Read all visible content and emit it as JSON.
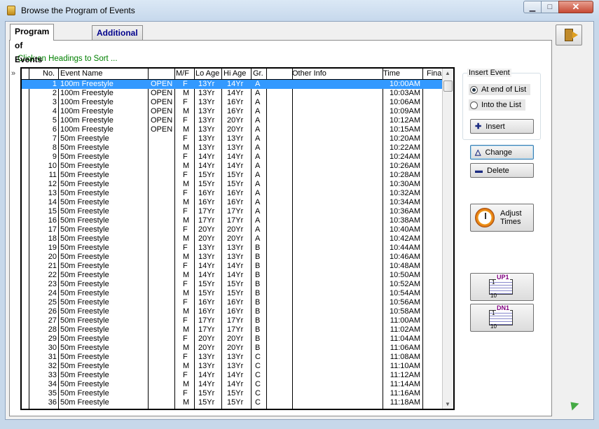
{
  "window": {
    "title": "Browse the Program of Events"
  },
  "tabs": [
    {
      "label": "Program of Events"
    },
    {
      "label": "Additional Program Items"
    }
  ],
  "hint": "Click on Headings to Sort ...",
  "grid": {
    "columns": [
      "No.",
      "Event Name",
      "",
      "M/F",
      "Lo Age",
      "Hi Age",
      "Gr.",
      "",
      "Other Info",
      "Time",
      "Final"
    ],
    "rows": [
      [
        "1",
        "100m Freestyle",
        "OPEN",
        "F",
        "13Yr",
        "14Yr",
        "A",
        "10:00AM"
      ],
      [
        "2",
        "100m Freestyle",
        "OPEN",
        "M",
        "13Yr",
        "14Yr",
        "A",
        "10:03AM"
      ],
      [
        "3",
        "100m Freestyle",
        "OPEN",
        "F",
        "13Yr",
        "16Yr",
        "A",
        "10:06AM"
      ],
      [
        "4",
        "100m Freestyle",
        "OPEN",
        "M",
        "13Yr",
        "16Yr",
        "A",
        "10:09AM"
      ],
      [
        "5",
        "100m Freestyle",
        "OPEN",
        "F",
        "13Yr",
        "20Yr",
        "A",
        "10:12AM"
      ],
      [
        "6",
        "100m Freestyle",
        "OPEN",
        "M",
        "13Yr",
        "20Yr",
        "A",
        "10:15AM"
      ],
      [
        "7",
        "50m Freestyle",
        "",
        "F",
        "13Yr",
        "13Yr",
        "A",
        "10:20AM"
      ],
      [
        "8",
        "50m Freestyle",
        "",
        "M",
        "13Yr",
        "13Yr",
        "A",
        "10:22AM"
      ],
      [
        "9",
        "50m Freestyle",
        "",
        "F",
        "14Yr",
        "14Yr",
        "A",
        "10:24AM"
      ],
      [
        "10",
        "50m Freestyle",
        "",
        "M",
        "14Yr",
        "14Yr",
        "A",
        "10:26AM"
      ],
      [
        "11",
        "50m Freestyle",
        "",
        "F",
        "15Yr",
        "15Yr",
        "A",
        "10:28AM"
      ],
      [
        "12",
        "50m Freestyle",
        "",
        "M",
        "15Yr",
        "15Yr",
        "A",
        "10:30AM"
      ],
      [
        "13",
        "50m Freestyle",
        "",
        "F",
        "16Yr",
        "16Yr",
        "A",
        "10:32AM"
      ],
      [
        "14",
        "50m Freestyle",
        "",
        "M",
        "16Yr",
        "16Yr",
        "A",
        "10:34AM"
      ],
      [
        "15",
        "50m Freestyle",
        "",
        "F",
        "17Yr",
        "17Yr",
        "A",
        "10:36AM"
      ],
      [
        "16",
        "50m Freestyle",
        "",
        "M",
        "17Yr",
        "17Yr",
        "A",
        "10:38AM"
      ],
      [
        "17",
        "50m Freestyle",
        "",
        "F",
        "20Yr",
        "20Yr",
        "A",
        "10:40AM"
      ],
      [
        "18",
        "50m Freestyle",
        "",
        "M",
        "20Yr",
        "20Yr",
        "A",
        "10:42AM"
      ],
      [
        "19",
        "50m Freestyle",
        "",
        "F",
        "13Yr",
        "13Yr",
        "B",
        "10:44AM"
      ],
      [
        "20",
        "50m Freestyle",
        "",
        "M",
        "13Yr",
        "13Yr",
        "B",
        "10:46AM"
      ],
      [
        "21",
        "50m Freestyle",
        "",
        "F",
        "14Yr",
        "14Yr",
        "B",
        "10:48AM"
      ],
      [
        "22",
        "50m Freestyle",
        "",
        "M",
        "14Yr",
        "14Yr",
        "B",
        "10:50AM"
      ],
      [
        "23",
        "50m Freestyle",
        "",
        "F",
        "15Yr",
        "15Yr",
        "B",
        "10:52AM"
      ],
      [
        "24",
        "50m Freestyle",
        "",
        "M",
        "15Yr",
        "15Yr",
        "B",
        "10:54AM"
      ],
      [
        "25",
        "50m Freestyle",
        "",
        "F",
        "16Yr",
        "16Yr",
        "B",
        "10:56AM"
      ],
      [
        "26",
        "50m Freestyle",
        "",
        "M",
        "16Yr",
        "16Yr",
        "B",
        "10:58AM"
      ],
      [
        "27",
        "50m Freestyle",
        "",
        "F",
        "17Yr",
        "17Yr",
        "B",
        "11:00AM"
      ],
      [
        "28",
        "50m Freestyle",
        "",
        "M",
        "17Yr",
        "17Yr",
        "B",
        "11:02AM"
      ],
      [
        "29",
        "50m Freestyle",
        "",
        "F",
        "20Yr",
        "20Yr",
        "B",
        "11:04AM"
      ],
      [
        "30",
        "50m Freestyle",
        "",
        "M",
        "20Yr",
        "20Yr",
        "B",
        "11:06AM"
      ],
      [
        "31",
        "50m Freestyle",
        "",
        "F",
        "13Yr",
        "13Yr",
        "C",
        "11:08AM"
      ],
      [
        "32",
        "50m Freestyle",
        "",
        "M",
        "13Yr",
        "13Yr",
        "C",
        "11:10AM"
      ],
      [
        "33",
        "50m Freestyle",
        "",
        "F",
        "14Yr",
        "14Yr",
        "C",
        "11:12AM"
      ],
      [
        "34",
        "50m Freestyle",
        "",
        "M",
        "14Yr",
        "14Yr",
        "C",
        "11:14AM"
      ],
      [
        "35",
        "50m Freestyle",
        "",
        "F",
        "15Yr",
        "15Yr",
        "C",
        "11:16AM"
      ],
      [
        "36",
        "50m Freestyle",
        "",
        "M",
        "15Yr",
        "15Yr",
        "C",
        "11:18AM"
      ]
    ],
    "selected_row": 1
  },
  "insert_event": {
    "label": "Insert Event",
    "options": [
      {
        "label": "At end of List",
        "checked": true
      },
      {
        "label": "Into the List",
        "checked": false
      }
    ],
    "insert_button": "Insert"
  },
  "buttons": {
    "change": "Change",
    "delete": "Delete",
    "adjust_line1": "Adjust",
    "adjust_line2": "Times",
    "up_label": "UP1",
    "dn_label": "DN1",
    "one": "1",
    "ten": "10"
  },
  "icons": {
    "exit": "exit-door-icon",
    "clock": "clock-icon",
    "plus": "plus-icon",
    "triangle": "triangle-up-icon",
    "minus": "minus-icon"
  },
  "colors": {
    "selection": "#3399ff",
    "hint": "#008000",
    "tab2_text": "#00008b"
  }
}
